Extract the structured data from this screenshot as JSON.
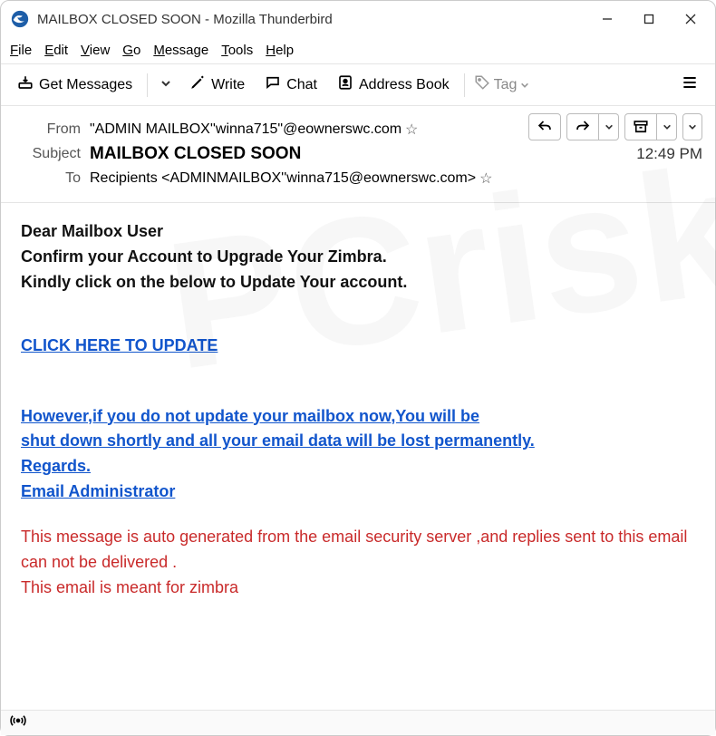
{
  "window": {
    "title": "MAILBOX CLOSED SOON - Mozilla Thunderbird"
  },
  "menu": {
    "file": "File",
    "edit": "Edit",
    "view": "View",
    "go": "Go",
    "message": "Message",
    "tools": "Tools",
    "help": "Help"
  },
  "toolbar": {
    "get_messages": "Get Messages",
    "write": "Write",
    "chat": "Chat",
    "address_book": "Address Book",
    "tag": "Tag"
  },
  "headers": {
    "from_label": "From",
    "from_value": "\"ADMIN MAILBOX''winna715\"@eownerswc.com",
    "subject_label": "Subject",
    "subject_value": "MAILBOX CLOSED SOON",
    "time": "12:49 PM",
    "to_label": "To",
    "to_value": "Recipients <ADMINMAILBOX''winna715@eownerswc.com>"
  },
  "body": {
    "greeting": "Dear Mailbox User",
    "line1": "Confirm your Account to Upgrade  Your Zimbra.",
    "line2": "Kindly click on the below to Update Your account.",
    "cta": "CLICK HERE TO UPDATE",
    "warn1": "However,if you do not update your mailbox now,You will be",
    "warn2": "shut down shortly and all your email data will be lost permanently.",
    "warn3": "Regards.",
    "warn4": "Email Administrator",
    "note1": "This message is auto generated from the email security server ,and replies sent to this email can not be delivered .",
    "note2": "This email is meant for zimbra"
  }
}
